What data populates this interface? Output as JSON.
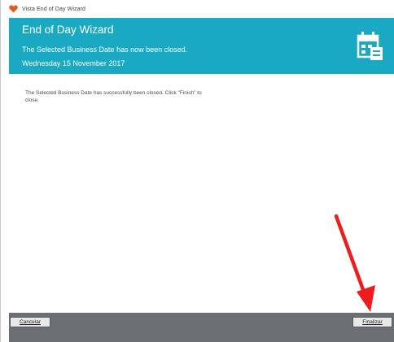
{
  "window": {
    "title": "Vista End of Day Wizard",
    "icon": "heart-icon"
  },
  "header": {
    "title": "End of Day Wizard",
    "line1": "The Selected Business Date has now been closed.",
    "line2": "Wednesday 15 November 2017",
    "icon": "calendar-icon",
    "bg_color": "#1aa9c2"
  },
  "main": {
    "message": "The Selected Business Date has successfully been closed.  Click \"Finish\" to close."
  },
  "footer": {
    "cancel_label": "Cancelar",
    "finish_label": "Finalizar",
    "bg_color": "#6b6e73"
  },
  "annotation": {
    "type": "red-arrow",
    "color": "#ee1c1c"
  }
}
